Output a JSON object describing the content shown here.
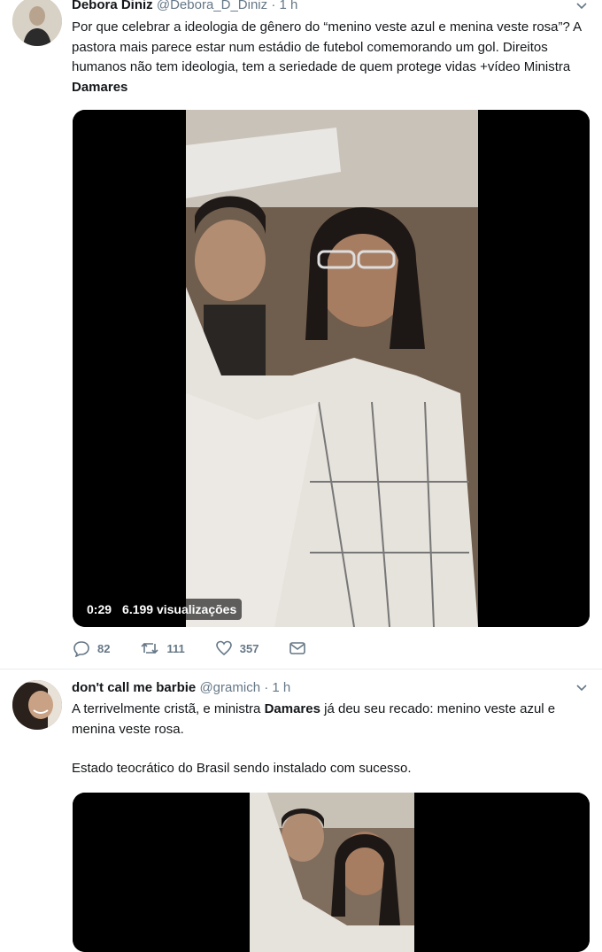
{
  "tweets": [
    {
      "author_name": "Debora Diniz",
      "handle": "@Debora_D_Diniz",
      "separator": "·",
      "time": "1 h",
      "text_before_bold": "Por que celebrar a ideologia de gênero do “menino veste azul e menina veste rosa”? A pastora mais parece estar num estádio de futebol comemorando um gol. Direitos humanos não tem ideologia, tem a seriedade de quem protege vidas +vídeo Ministra ",
      "text_bold": "Damares",
      "video": {
        "duration": "0:29",
        "views": "6.199 visualizações"
      },
      "actions": {
        "replies": "82",
        "retweets": "111",
        "likes": "357"
      }
    },
    {
      "author_name": "don't call me barbie",
      "handle": "@gramich",
      "separator": "·",
      "time": "1 h",
      "text_before_bold": "A terrivelmente cristã, e ministra ",
      "text_bold": "Damares",
      "text_after_bold": " já deu seu recado: menino veste azul e menina veste rosa.",
      "text_paragraph_2": "Estado teocrático do Brasil sendo instalado com sucesso."
    }
  ],
  "icons": [
    "reply-icon",
    "retweet-icon",
    "like-icon",
    "message-icon",
    "chevron-down-icon"
  ],
  "colors": {
    "muted": "#657786",
    "text": "#14171a",
    "divider": "#e6ecf0"
  }
}
